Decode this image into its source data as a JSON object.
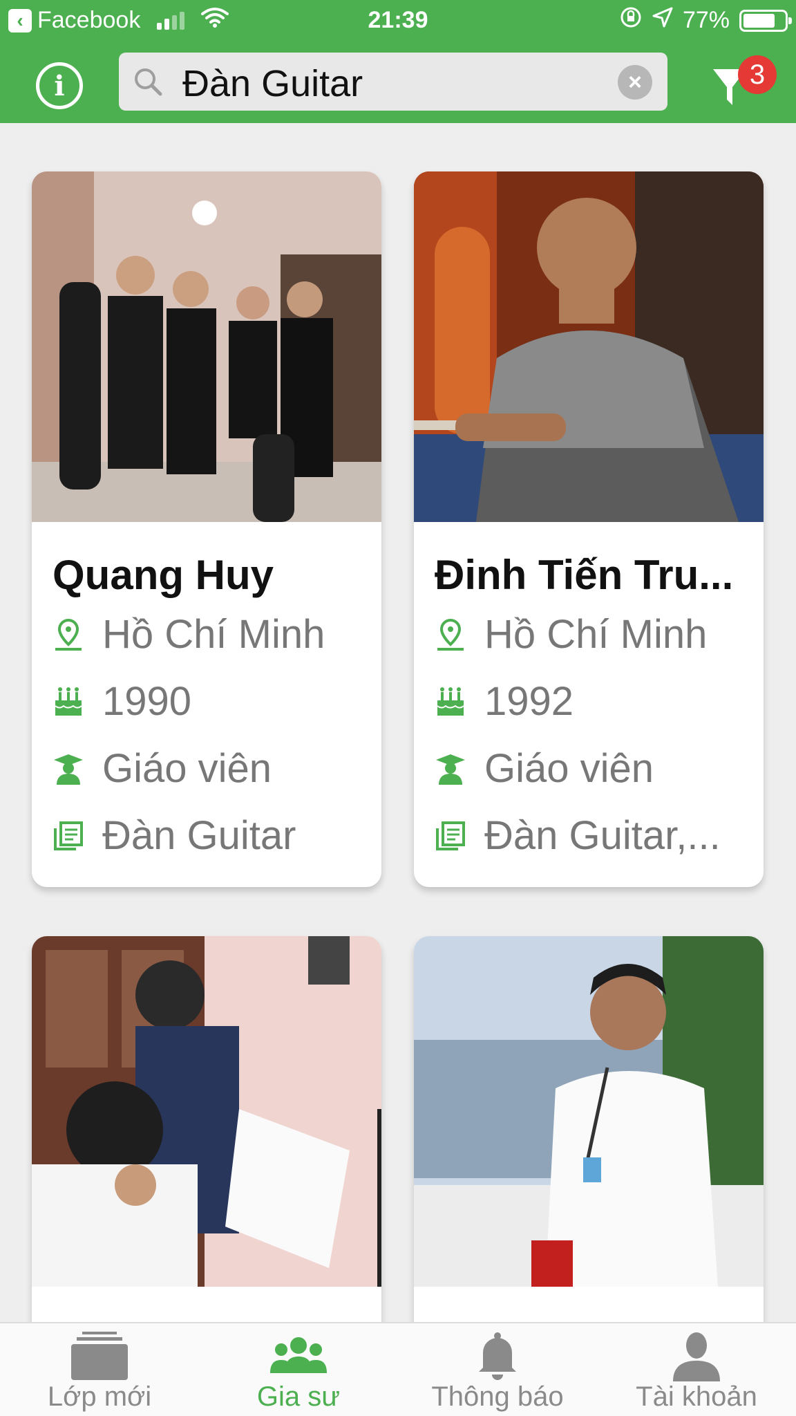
{
  "status_bar": {
    "back_app": "Facebook",
    "time": "21:39",
    "battery": "77%",
    "battery_level": 0.77
  },
  "toolbar": {
    "search_value": "Đàn Guitar",
    "filter_count": "3"
  },
  "tutors": [
    {
      "name": "Quang Huy",
      "location": "Hồ Chí Minh",
      "birth_year": "1990",
      "occupation": "Giáo viên",
      "subjects": "Đàn Guitar"
    },
    {
      "name": "Đinh Tiến Tru...",
      "location": "Hồ Chí Minh",
      "birth_year": "1992",
      "occupation": "Giáo viên",
      "subjects": "Đàn Guitar,..."
    },
    {
      "name": "",
      "location": "",
      "birth_year": "",
      "occupation": "",
      "subjects": ""
    },
    {
      "name": "",
      "location": "",
      "birth_year": "",
      "occupation": "",
      "subjects": ""
    }
  ],
  "tabs": [
    {
      "label": "Lớp mới",
      "icon": "class-box-icon"
    },
    {
      "label": "Gia sư",
      "icon": "tutors-group-icon"
    },
    {
      "label": "Thông báo",
      "icon": "bell-icon"
    },
    {
      "label": "Tài khoản",
      "icon": "user-icon"
    }
  ],
  "colors": {
    "brand_green": "#4caf50",
    "badge_red": "#e53935",
    "tab_inactive": "#8a8a8a"
  }
}
